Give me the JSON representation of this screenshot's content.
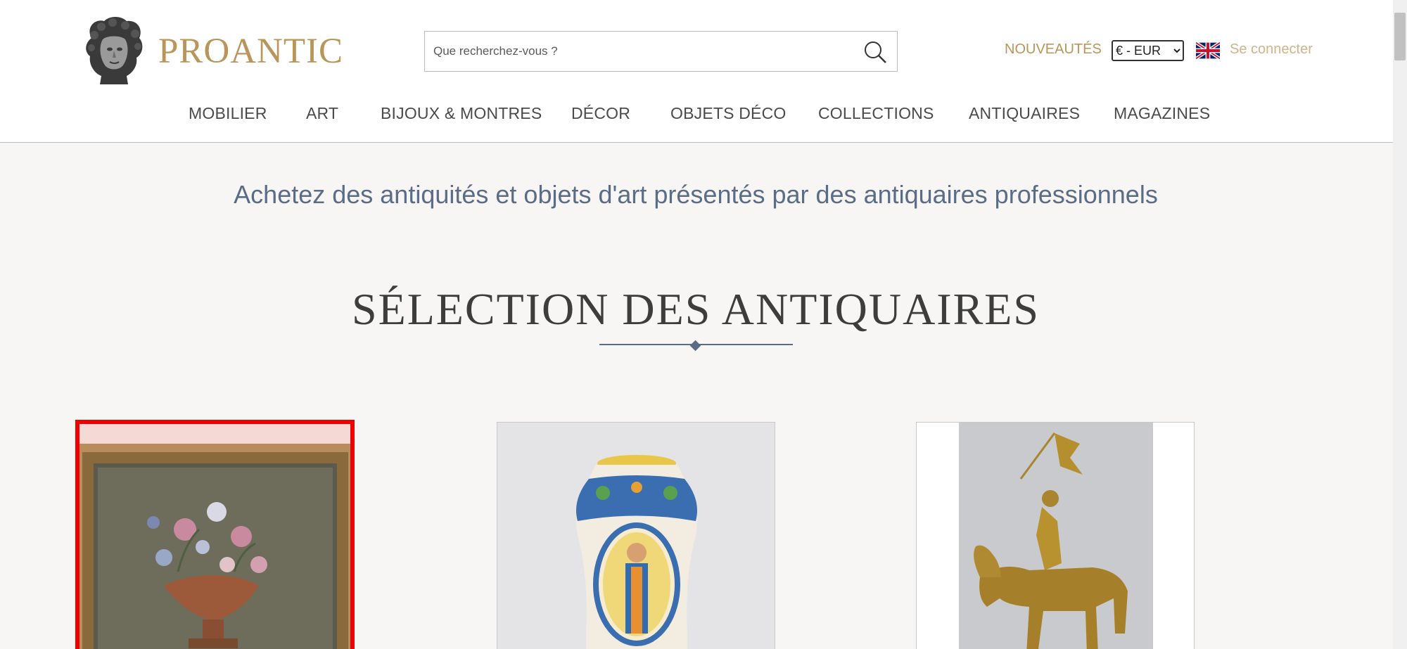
{
  "header": {
    "brand": "PROANTIC",
    "search": {
      "placeholder": "Que recherchez-vous ?"
    },
    "nouveautes": "NOUVEAUTÉS",
    "currency": {
      "selected": "€ - EUR",
      "options": [
        "€ - EUR"
      ]
    },
    "login": "Se connecter"
  },
  "nav": {
    "items": [
      {
        "label": "MOBILIER"
      },
      {
        "label": "ART"
      },
      {
        "label": "BIJOUX & MONTRES"
      },
      {
        "label": "DÉCOR"
      },
      {
        "label": "OBJETS DÉCO"
      },
      {
        "label": "COLLECTIONS"
      },
      {
        "label": "ANTIQUAIRES"
      },
      {
        "label": "MAGAZINES"
      }
    ]
  },
  "main": {
    "tagline": "Achetez des antiquités et objets d'art présentés par des antiquaires professionnels",
    "section_title": "SÉLECTION DES ANTIQUAIRES"
  },
  "colors": {
    "brand_gold": "#b9955a",
    "tagline_blue": "#5a6c86",
    "highlight_red": "#ee0000"
  },
  "icons": [
    "bust-logo-icon",
    "search-icon",
    "uk-flag-icon"
  ]
}
